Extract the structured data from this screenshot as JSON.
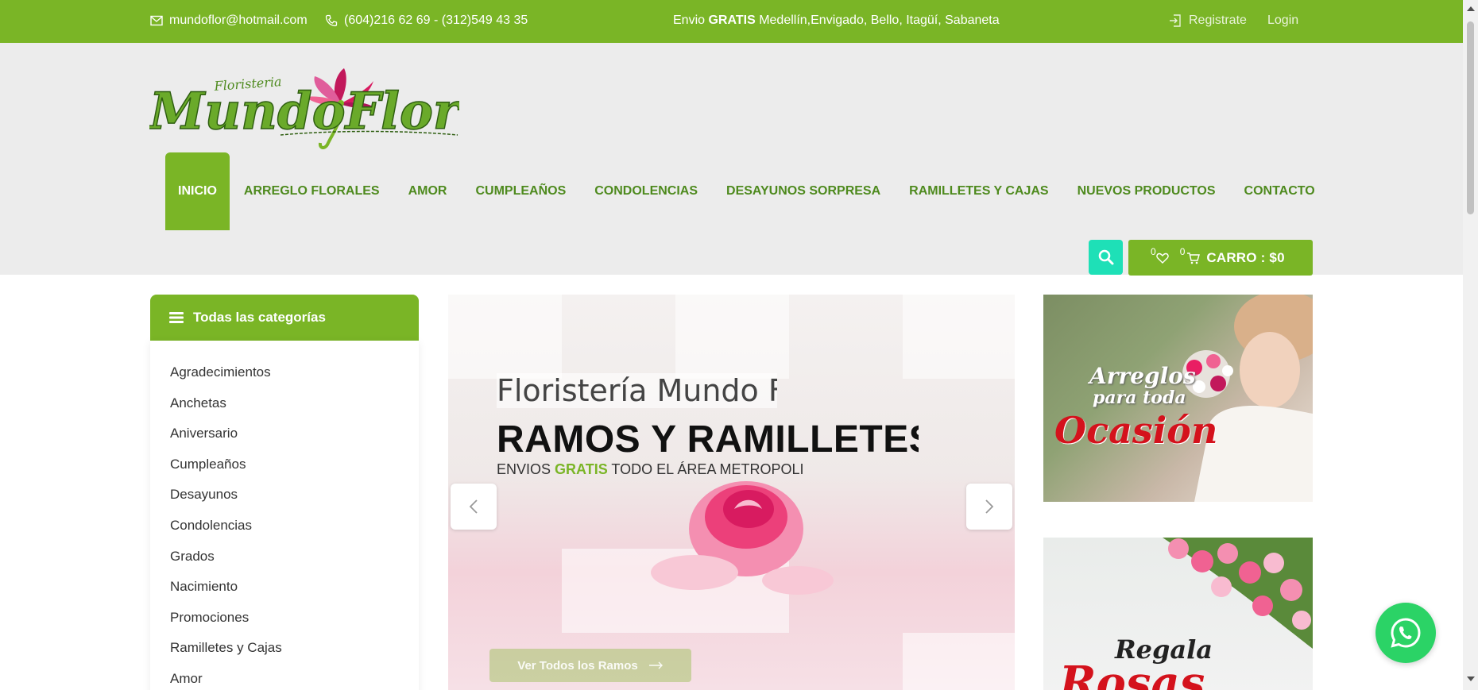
{
  "topbar": {
    "email": "mundoflor@hotmail.com",
    "phone": "(604)216 62 69 - (312)549 43 35",
    "shipping_prefix": "Envio",
    "shipping_bold": "GRATIS",
    "shipping_suffix": "Medellín,Envigado, Bello, Itagüí, Sabaneta",
    "register": "Registrate",
    "login": "Login"
  },
  "logo": {
    "small": "Floristeria",
    "big": "MundoFlor"
  },
  "nav": {
    "items": [
      "INICIO",
      "ARREGLO FLORALES",
      "AMOR",
      "CUMPLEAÑOS",
      "CONDOLENCIAS",
      "DESAYUNOS SORPRESA",
      "RAMILLETES Y CAJAS",
      "NUEVOS PRODUCTOS",
      "CONTACTO"
    ]
  },
  "cart": {
    "wishlist_count": "0",
    "cart_count": "0",
    "label": "CARRO : $0"
  },
  "categories": {
    "title": "Todas las categorías",
    "items": [
      "Agradecimientos",
      "Anchetas",
      "Aniversario",
      "Cumpleaños",
      "Desayunos",
      "Condolencias",
      "Grados",
      "Nacimiento",
      "Promociones",
      "Ramilletes y Cajas",
      "Amor"
    ]
  },
  "slider": {
    "title": "Floristería Mundo Flor",
    "heading": "RAMOS Y RAMILLETES",
    "sub_prefix": "ENVIOS",
    "sub_green": "GRATIS",
    "sub_suffix": "TODO EL ÁREA METROPOLITANA",
    "button": "Ver Todos los Ramos"
  },
  "banners": {
    "b1_line1": "Arreglos",
    "b1_line2": "para toda",
    "b1_line3": "Ocasión",
    "b2_line1": "Regala",
    "b2_line2": "Rosas"
  },
  "colors": {
    "brand_green": "#7ab526",
    "nav_green": "#4e8a1e",
    "search_teal": "#1ee0b7",
    "whatsapp": "#2bd366"
  }
}
